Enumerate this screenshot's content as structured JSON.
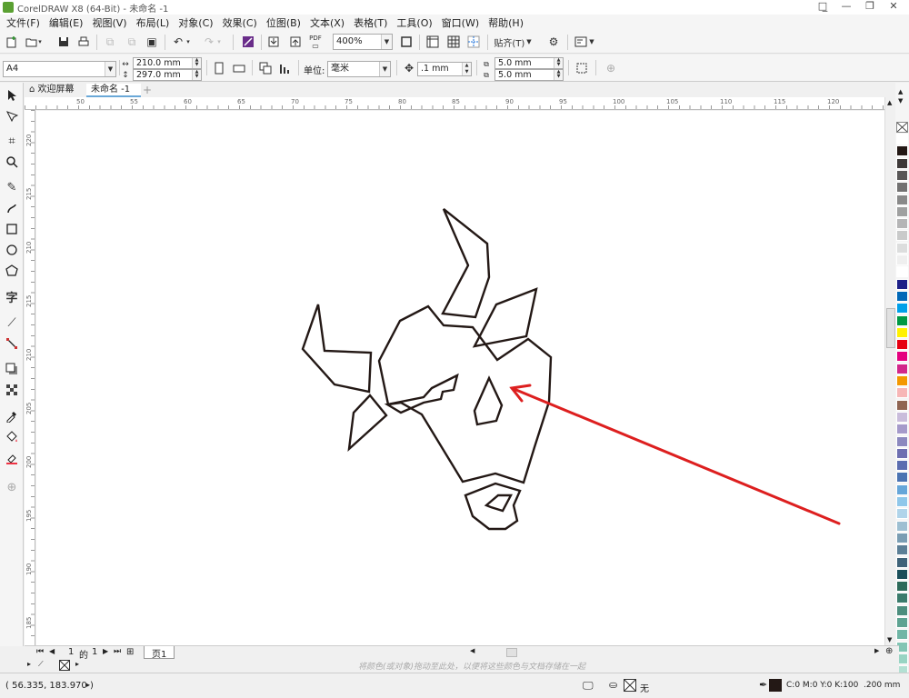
{
  "window": {
    "title": "CorelDRAW X8 (64-Bit) - 未命名 -1",
    "controls": [
      "□̲",
      "—",
      "❐",
      "✕"
    ]
  },
  "menu": [
    "文件(F)",
    "编辑(E)",
    "视图(V)",
    "布局(L)",
    "对象(C)",
    "效果(C)",
    "位图(B)",
    "文本(X)",
    "表格(T)",
    "工具(O)",
    "窗口(W)",
    "帮助(H)"
  ],
  "toolbar": {
    "zoom_value": "400%",
    "snap_label": "贴齐(T)",
    "pdf_label": "PDF"
  },
  "property_bar": {
    "page_size": "A4",
    "width": "210.0 mm",
    "height": "297.0 mm",
    "unit_label": "单位:",
    "unit_value": "毫米",
    "nudge": ".1 mm",
    "dup_x": "5.0 mm",
    "dup_y": "5.0 mm"
  },
  "tabs": {
    "welcome": "欢迎屏幕",
    "document": "未命名 -1",
    "add": "+"
  },
  "ruler": {
    "h_ticks": [
      "50",
      "55",
      "60",
      "65",
      "70",
      "75",
      "80",
      "85",
      "90",
      "95",
      "100",
      "105",
      "110",
      "115",
      "120"
    ],
    "v_ticks": [
      "220",
      "215",
      "210",
      "215",
      "210",
      "205",
      "200",
      "195",
      "190",
      "185"
    ]
  },
  "page_nav": {
    "current": "1",
    "of_label": "的",
    "total": "1",
    "page_tab": "页1"
  },
  "hint_text": "将颜色(或对象)拖动至此处，以便将这些颜色与文档存储在一起",
  "status": {
    "coords": "( 56.335, 183.970 )",
    "fill_none": "无",
    "outline_color": "C:0 M:0 Y:0 K:100",
    "outline_width": ".200 mm"
  },
  "colors": {
    "accent": "#cc0000",
    "arrow": "#dd1f1f",
    "stroke": "#231815"
  },
  "palette": [
    "#ffffff",
    "#231815",
    "#3e3a39",
    "#595757",
    "#727171",
    "#898989",
    "#9fa0a0",
    "#b5b5b6",
    "#c9caca",
    "#dcdddd",
    "#efefef",
    "#ffffff",
    "#1d2088",
    "#0068b7",
    "#00a0e9",
    "#009944",
    "#fff100",
    "#e60012",
    "#e4007f",
    "#d2278a",
    "#f39800",
    "#f7b6b6",
    "#8f6552",
    "#c9bcdb",
    "#a59aca",
    "#8c89bf",
    "#6e6fb1",
    "#5b6db0",
    "#4a73b2",
    "#66a6d9",
    "#8fc7ea",
    "#b0d4ea",
    "#9dbfd2",
    "#7a9db3",
    "#5c7f96",
    "#3f6379",
    "#1b4f5a",
    "#2d6a5a",
    "#3b7b6c",
    "#4d8e7e",
    "#5ea392",
    "#70b6a6",
    "#82c5b4",
    "#98d4c3",
    "#b3e0d3"
  ]
}
